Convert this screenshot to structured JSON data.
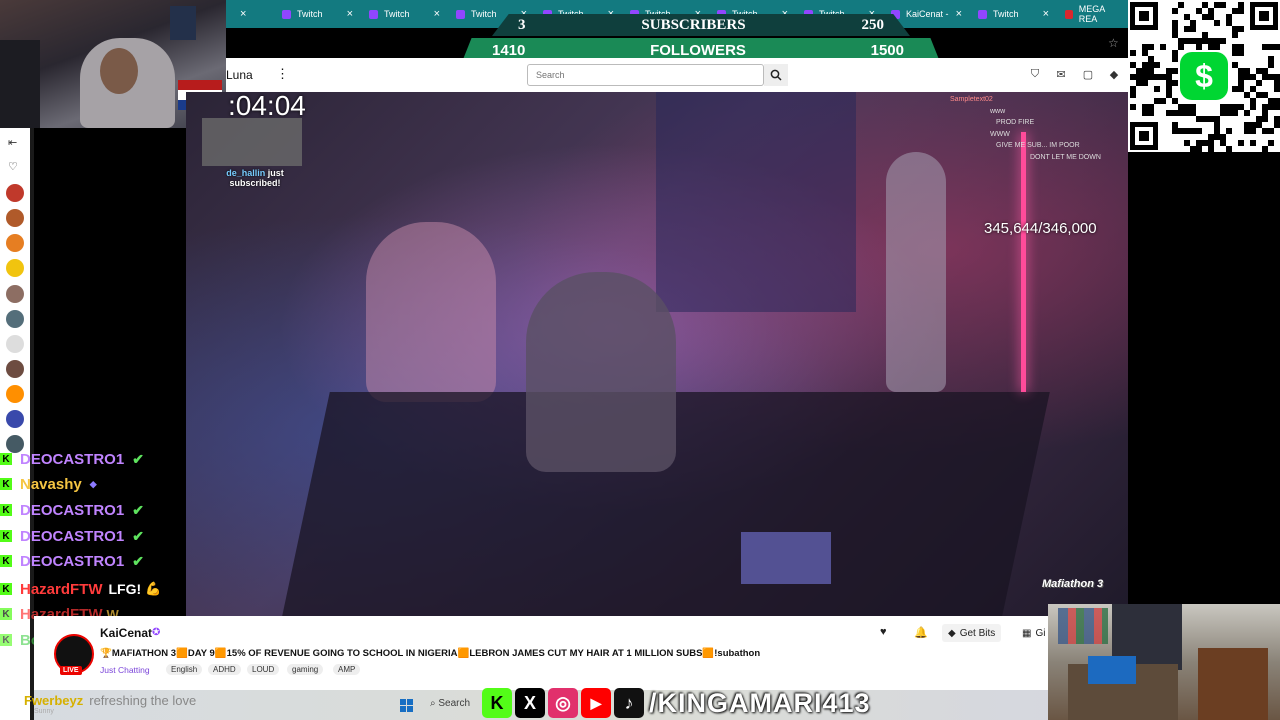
{
  "tabstrip": {
    "tabs": [
      {
        "label": ""
      },
      {
        "label": "Twitch"
      },
      {
        "label": "Twitch"
      },
      {
        "label": "Twitch"
      },
      {
        "label": "Twitch"
      },
      {
        "label": "Twitch"
      },
      {
        "label": "Twitch"
      },
      {
        "label": "Twitch"
      },
      {
        "label": "KaiCenat -"
      },
      {
        "label": "Twitch"
      },
      {
        "label": "MEGA REA"
      }
    ]
  },
  "goal_banner": {
    "subscribers_left": "3",
    "subscribers_label": "SUBSCRIBERS",
    "subscribers_right": "250",
    "followers_left": "1410",
    "followers_label": "FOLLOWERS",
    "followers_right": "1500"
  },
  "topnav": {
    "user": "Luna",
    "search_placeholder": "Search"
  },
  "stream_overlay": {
    "timer": ":04:04",
    "sub_alert_name": "de_hallin",
    "sub_alert_text": "just subscribed!",
    "bits_counter": "345,644/346,000",
    "watermark": "Mafiathon 3",
    "overlay_chat": [
      {
        "name": "Sampletext02",
        "msg": ""
      },
      {
        "name": "",
        "msg": "www"
      },
      {
        "name": "",
        "msg": "PROD FIRE"
      },
      {
        "name": "",
        "msg": "WWW"
      },
      {
        "name": "",
        "msg": "GIVE ME SUB... IM POOR"
      },
      {
        "name": "",
        "msg": "DONT LET ME DOWN"
      }
    ]
  },
  "chat_overlay": [
    {
      "name": "DEOCASTRO1",
      "color": "#c084ff",
      "msg": ""
    },
    {
      "name": "Navashy",
      "color": "#f5c542",
      "msg": ""
    },
    {
      "name": "DEOCASTRO1",
      "color": "#c084ff",
      "msg": ""
    },
    {
      "name": "DEOCASTRO1",
      "color": "#c084ff",
      "msg": ""
    },
    {
      "name": "DEOCASTRO1",
      "color": "#c084ff",
      "msg": ""
    },
    {
      "name": "HazardFTW",
      "color": "#ff3b3b",
      "msg": "LFG!"
    },
    {
      "name": "HazardFTW",
      "color": "#ff3b3b",
      "msg": ""
    },
    {
      "name": "BotRix",
      "color": "#44d04a",
      "msg": ""
    }
  ],
  "bottom_chat": {
    "name": "Fwerbeyz",
    "msg": "refreshing the love",
    "sub": "Sunny"
  },
  "channel": {
    "name": "KaiCenat",
    "live_badge": "LIVE",
    "title": "🏆MAFIATHON 3🟧DAY 9🟧15% OF REVENUE GOING TO SCHOOL IN NIGERIA🟧LEBRON JAMES CUT MY HAIR AT 1 MILLION SUBS🟧!subathon",
    "category": "Just Chatting",
    "tags": [
      "English",
      "ADHD",
      "LOUD",
      "gaming",
      "AMP"
    ],
    "get_bits_label": "Get Bits",
    "gift_label": "Gi"
  },
  "taskbar": {
    "search_label": "Search"
  },
  "socials": {
    "handle": "/KINGAMARI413",
    "icons": [
      {
        "name": "kick-icon",
        "color": "#53fc18",
        "glyph": "K"
      },
      {
        "name": "x-icon",
        "color": "#000000",
        "glyph": "X"
      },
      {
        "name": "instagram-icon",
        "color": "#e1306c",
        "glyph": "◎"
      },
      {
        "name": "youtube-icon",
        "color": "#ff0000",
        "glyph": "▶"
      },
      {
        "name": "tiktok-icon",
        "color": "#111111",
        "glyph": "♪"
      }
    ]
  },
  "colors": {
    "tabstrip": "#137a80",
    "subscribers_bar": "#0f3f3d",
    "followers_bar": "#1a8a56",
    "twitch_purple": "#9146ff",
    "cashapp_green": "#00d632"
  }
}
